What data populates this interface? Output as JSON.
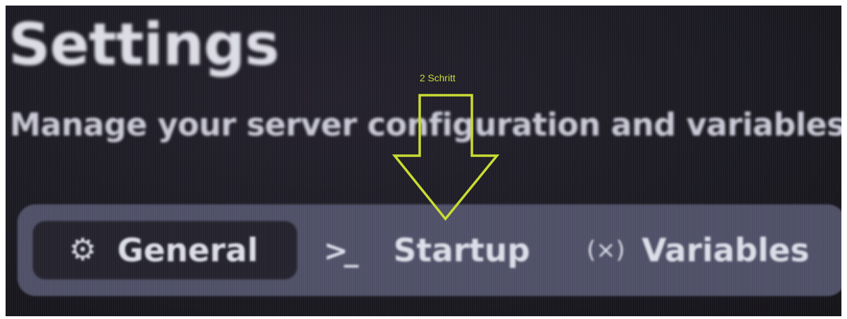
{
  "header": {
    "title": "Settings",
    "subtitle": "Manage your server configuration and variables"
  },
  "tabs": [
    {
      "label": "General",
      "icon": "gear-icon",
      "active": true
    },
    {
      "label": "Startup",
      "icon": "terminal-icon",
      "active": false
    },
    {
      "label": "Variables",
      "icon": "variables-icon",
      "active": false
    }
  ],
  "icons": {
    "gear": "⚙",
    "terminal": ">_",
    "variables": "(×)"
  },
  "annotation": {
    "label": "2 Schritt",
    "icon": "down-arrow-icon",
    "color": "#c9dc34"
  },
  "colors": {
    "background": "#1b1a22",
    "tabbar": "#4f5067",
    "active_tab": "#24232d",
    "text": "#dcdde8"
  }
}
